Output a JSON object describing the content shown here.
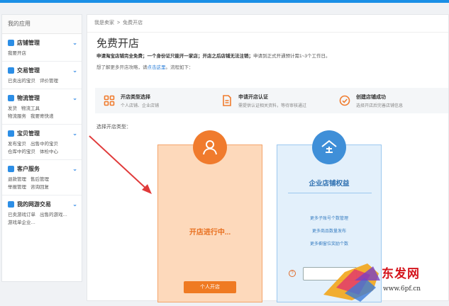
{
  "sidebar": {
    "header": "我的应用",
    "groups": [
      {
        "title": "店铺管理",
        "links": [
          "我要开店"
        ]
      },
      {
        "title": "交易管理",
        "links": [
          "已卖出的宝贝",
          "评价管理"
        ]
      },
      {
        "title": "物流管理",
        "links": [
          "发货",
          "物流工具",
          "物流服务",
          "我要寄快递"
        ]
      },
      {
        "title": "宝贝管理",
        "links": [
          "发布宝贝",
          "出售中的宝贝",
          "仓库中的宝贝",
          "体检中心"
        ]
      },
      {
        "title": "客户服务",
        "links": [
          "退款管理",
          "售后管理",
          "举报管理",
          "咨询回复"
        ]
      },
      {
        "title": "我的网游交易",
        "links": [
          "已卖游戏订单",
          "出售的游戏…",
          "游戏单企业…"
        ]
      }
    ]
  },
  "breadcrumb": {
    "home": "我是卖家",
    "sep": ">",
    "current": "免费开店"
  },
  "page": {
    "title": "免费开店",
    "desc_bold": "申请淘宝店铺完全免费；一个身份证只能开一家店；开店之后店铺无法注销；",
    "desc_rest": "申请到正式开通预计需1~3个工作日。",
    "desc2_prefix": "想了解更多开店攻略，请",
    "desc2_link": "点击这里",
    "desc2_suffix": "。流程如下：",
    "choose_label": "选择开店类型："
  },
  "steps": [
    {
      "title": "开店类型选择",
      "sub": "个人店铺、企业店铺"
    },
    {
      "title": "申请开店认证",
      "sub": "需提供认证相关资料，等待审核通过"
    },
    {
      "title": "创建店铺成功",
      "sub": "选择开店后完善店铺信息"
    }
  ],
  "personal_card": {
    "status": "开店进行中...",
    "button": "个人开店"
  },
  "enterprise_card": {
    "title": "企业店铺权益",
    "features": [
      "更多子账号个数管理",
      "更多商品数量发布",
      "更多橱窗位奖励个数"
    ],
    "help": "?"
  },
  "watermark": {
    "text": "东发网",
    "url": "www.6pf.cn"
  },
  "colors": {
    "accent_blue": "#1b8fe6",
    "orange": "#f07b2d",
    "enterprise_blue": "#3f8fd8"
  }
}
